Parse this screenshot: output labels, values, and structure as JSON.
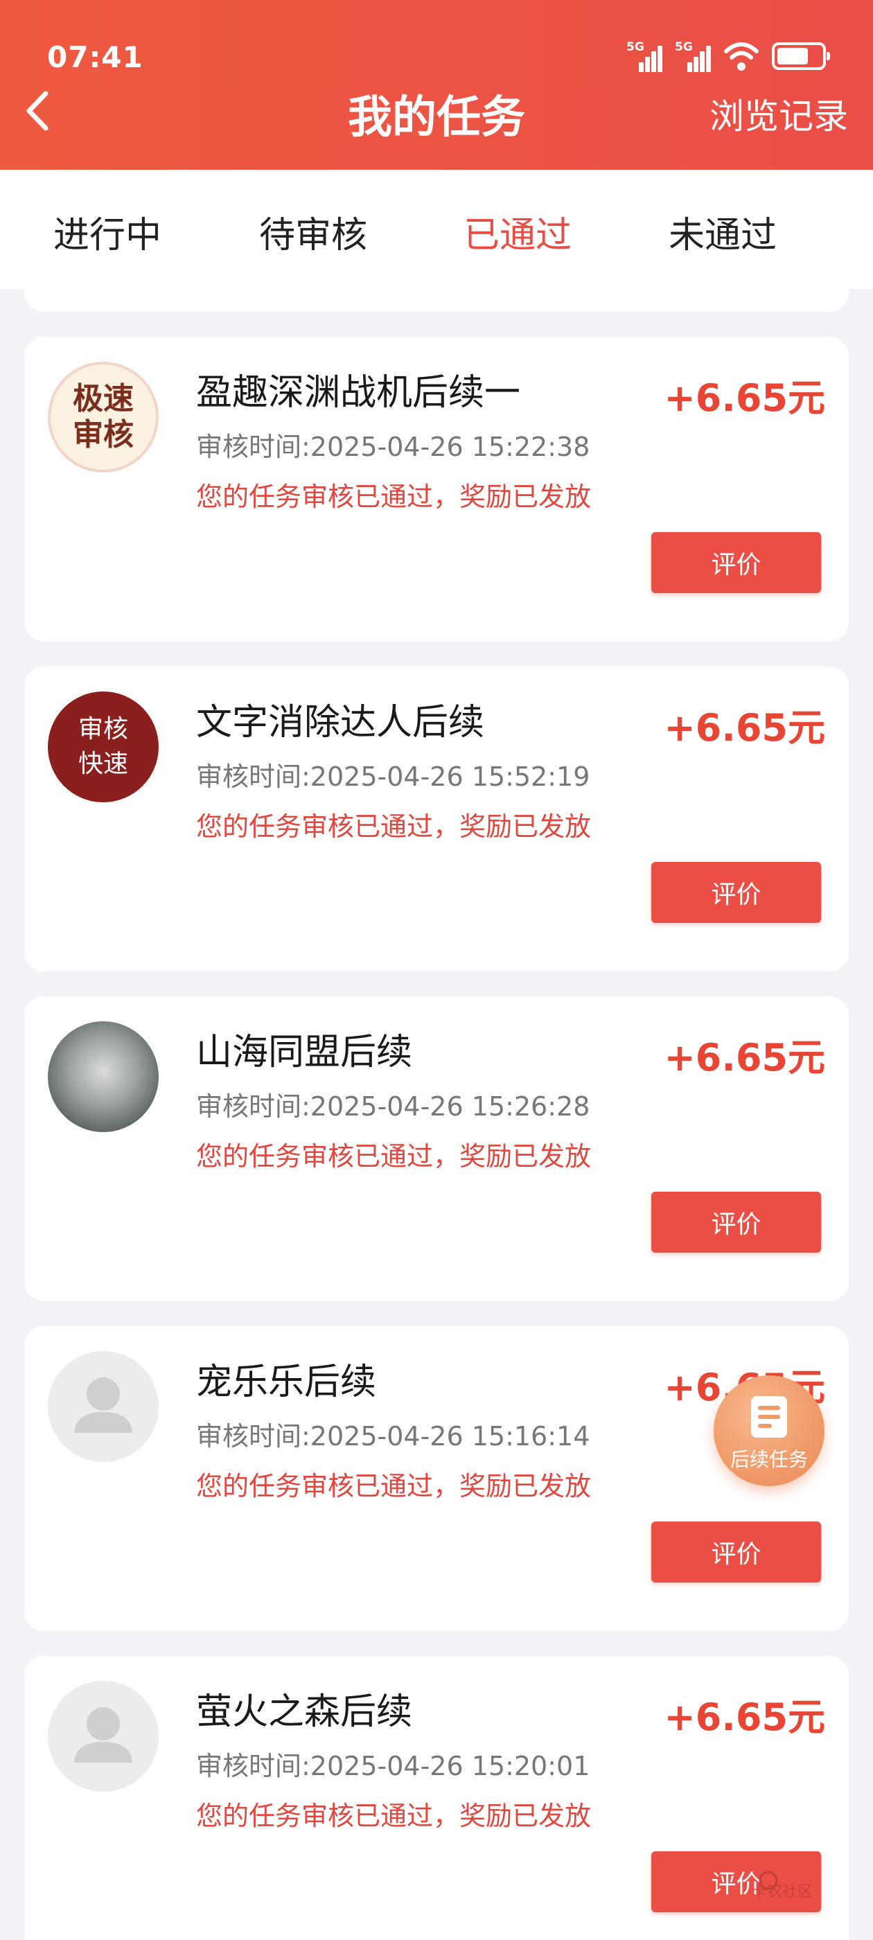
{
  "status_bar": {
    "time": "07:41",
    "signal1": "5G",
    "signal2": "5G"
  },
  "header": {
    "title": "我的任务",
    "history_label": "浏览记录"
  },
  "tabs": [
    {
      "label": "进行中"
    },
    {
      "label": "待审核"
    },
    {
      "label": "已通过",
      "active": true
    },
    {
      "label": "未通过"
    }
  ],
  "tasks": [
    {
      "title": "盈趣深渊战机后续一",
      "reward": "+6.65元",
      "review_time": "审核时间:2025-04-26 15:22:38",
      "status": "您的任务审核已通过，奖励已发放",
      "button": "评价",
      "avatar_text": [
        "极速",
        "审核"
      ]
    },
    {
      "title": "文字消除达人后续",
      "reward": "+6.65元",
      "review_time": "审核时间:2025-04-26 15:52:19",
      "status": "您的任务审核已通过，奖励已发放",
      "button": "评价",
      "avatar_text": [
        "审核",
        "快速"
      ]
    },
    {
      "title": "山海同盟后续",
      "reward": "+6.65元",
      "review_time": "审核时间:2025-04-26 15:26:28",
      "status": "您的任务审核已通过，奖励已发放",
      "button": "评价"
    },
    {
      "title": "宠乐乐后续",
      "reward": "+6.65元",
      "review_time": "审核时间:2025-04-26 15:16:14",
      "status": "您的任务审核已通过，奖励已发放",
      "button": "评价"
    },
    {
      "title": "萤火之森后续",
      "reward": "+6.65元",
      "review_time": "审核时间:2025-04-26 15:20:01",
      "status": "您的任务审核已通过，奖励已发放",
      "button": "评价"
    }
  ],
  "fab": {
    "label": "后续任务"
  },
  "watermark": "卡农社区",
  "colors": {
    "header": "#ec5444",
    "accent": "#e84d43",
    "reward": "#e84535",
    "fab": "#f09a69"
  }
}
